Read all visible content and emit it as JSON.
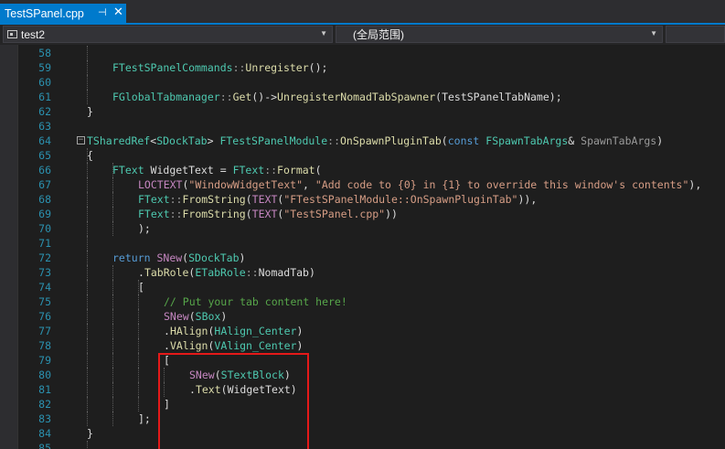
{
  "tab": {
    "title": "TestSPanel.cpp",
    "pin_glyph": "⊣",
    "close_glyph": "✕"
  },
  "nav": {
    "project": "test2",
    "scope": "(全局范围)"
  },
  "lines": [
    {
      "num": "58",
      "code": []
    },
    {
      "num": "59",
      "code": [
        [
          "t",
          "FTestSPanelCommands"
        ],
        [
          "p",
          "::"
        ],
        [
          "fn",
          "Unregister"
        ],
        [
          "d",
          "();"
        ]
      ]
    },
    {
      "num": "60",
      "code": []
    },
    {
      "num": "61",
      "code": [
        [
          "t",
          "FGlobalTabmanager"
        ],
        [
          "p",
          "::"
        ],
        [
          "fn",
          "Get"
        ],
        [
          "d",
          "()->"
        ],
        [
          "fn",
          "UnregisterNomadTabSpawner"
        ],
        [
          "d",
          "(TestSPanelTabName);"
        ]
      ]
    },
    {
      "num": "62",
      "code": [
        [
          "d",
          "}"
        ]
      ]
    },
    {
      "num": "63",
      "code": []
    },
    {
      "num": "64",
      "collapse": "−",
      "code": [
        [
          "t",
          "TSharedRef"
        ],
        [
          "d",
          "<"
        ],
        [
          "t",
          "SDockTab"
        ],
        [
          "d",
          "> "
        ],
        [
          "t",
          "FTestSPanelModule"
        ],
        [
          "p",
          "::"
        ],
        [
          "fn",
          "OnSpawnPluginTab"
        ],
        [
          "d",
          "("
        ],
        [
          "k",
          "const "
        ],
        [
          "t",
          "FSpawnTabArgs"
        ],
        [
          "d",
          "& "
        ],
        [
          "p",
          "SpawnTabArgs"
        ],
        [
          "d",
          ")"
        ]
      ]
    },
    {
      "num": "65",
      "code": [
        [
          "d",
          "{"
        ]
      ]
    },
    {
      "num": "66",
      "code": [
        [
          "t",
          "FText"
        ],
        [
          "d",
          " WidgetText = "
        ],
        [
          "t",
          "FText"
        ],
        [
          "p",
          "::"
        ],
        [
          "fn",
          "Format"
        ],
        [
          "d",
          "("
        ]
      ]
    },
    {
      "num": "67",
      "code": [
        [
          "m",
          "LOCTEXT"
        ],
        [
          "d",
          "("
        ],
        [
          "s",
          "\"WindowWidgetText\""
        ],
        [
          "d",
          ", "
        ],
        [
          "s",
          "\"Add code to {0} in {1} to override this window's contents\""
        ],
        [
          "d",
          "),"
        ]
      ]
    },
    {
      "num": "68",
      "code": [
        [
          "t",
          "FText"
        ],
        [
          "p",
          "::"
        ],
        [
          "fn",
          "FromString"
        ],
        [
          "d",
          "("
        ],
        [
          "m",
          "TEXT"
        ],
        [
          "d",
          "("
        ],
        [
          "s",
          "\"FTestSPanelModule::OnSpawnPluginTab\""
        ],
        [
          "d",
          ")),"
        ]
      ]
    },
    {
      "num": "69",
      "code": [
        [
          "t",
          "FText"
        ],
        [
          "p",
          "::"
        ],
        [
          "fn",
          "FromString"
        ],
        [
          "d",
          "("
        ],
        [
          "m",
          "TEXT"
        ],
        [
          "d",
          "("
        ],
        [
          "s",
          "\"TestSPanel.cpp\""
        ],
        [
          "d",
          "))"
        ]
      ]
    },
    {
      "num": "70",
      "code": [
        [
          "d",
          ");"
        ]
      ]
    },
    {
      "num": "71",
      "code": []
    },
    {
      "num": "72",
      "code": [
        [
          "k",
          "return "
        ],
        [
          "m",
          "SNew"
        ],
        [
          "d",
          "("
        ],
        [
          "t",
          "SDockTab"
        ],
        [
          "d",
          ")"
        ]
      ]
    },
    {
      "num": "73",
      "code": [
        [
          "d",
          "."
        ],
        [
          "fn",
          "TabRole"
        ],
        [
          "d",
          "("
        ],
        [
          "t",
          "ETabRole"
        ],
        [
          "p",
          "::"
        ],
        [
          "d",
          "NomadTab)"
        ]
      ]
    },
    {
      "num": "74",
      "code": [
        [
          "d",
          "["
        ]
      ]
    },
    {
      "num": "75",
      "code": [
        [
          "c",
          "// Put your tab content here!"
        ]
      ]
    },
    {
      "num": "76",
      "code": [
        [
          "m",
          "SNew"
        ],
        [
          "d",
          "("
        ],
        [
          "t",
          "SBox"
        ],
        [
          "d",
          ")"
        ]
      ]
    },
    {
      "num": "77",
      "code": [
        [
          "d",
          "."
        ],
        [
          "fn",
          "HAlign"
        ],
        [
          "d",
          "("
        ],
        [
          "t",
          "HAlign_Center"
        ],
        [
          "d",
          ")"
        ]
      ]
    },
    {
      "num": "78",
      "code": [
        [
          "d",
          "."
        ],
        [
          "fn",
          "VAlign"
        ],
        [
          "d",
          "("
        ],
        [
          "t",
          "VAlign_Center"
        ],
        [
          "d",
          ")"
        ]
      ]
    },
    {
      "num": "79",
      "code": [
        [
          "d",
          "["
        ]
      ]
    },
    {
      "num": "80",
      "code": [
        [
          "m",
          "SNew"
        ],
        [
          "d",
          "("
        ],
        [
          "t",
          "STextBlock"
        ],
        [
          "d",
          ")"
        ]
      ]
    },
    {
      "num": "81",
      "code": [
        [
          "d",
          "."
        ],
        [
          "fn",
          "Text"
        ],
        [
          "d",
          "(WidgetText)"
        ]
      ]
    },
    {
      "num": "82",
      "code": [
        [
          "d",
          "]"
        ]
      ]
    },
    {
      "num": "83",
      "code": [
        [
          "d",
          "];"
        ]
      ]
    },
    {
      "num": "84",
      "code": [
        [
          "d",
          "}"
        ]
      ]
    },
    {
      "num": "85",
      "code": []
    }
  ]
}
